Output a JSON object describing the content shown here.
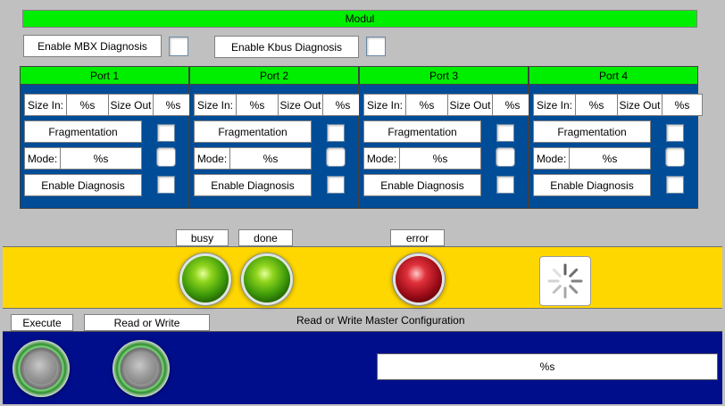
{
  "header": {
    "title": "Modul"
  },
  "global": {
    "mbx_diagnosis_label": "Enable MBX Diagnosis",
    "kbus_diagnosis_label": "Enable Kbus Diagnosis"
  },
  "ports": [
    {
      "title": "Port 1",
      "size_in_label": "Size In:",
      "size_in_value": "%s",
      "size_out_label": "Size Out",
      "size_out_value": "%s",
      "fragmentation_label": "Fragmentation",
      "mode_label": "Mode:",
      "mode_value": "%s",
      "enable_diagnosis_label": "Enable Diagnosis"
    },
    {
      "title": "Port 2",
      "size_in_label": "Size In:",
      "size_in_value": "%s",
      "size_out_label": "Size Out",
      "size_out_value": "%s",
      "fragmentation_label": "Fragmentation",
      "mode_label": "Mode:",
      "mode_value": "%s",
      "enable_diagnosis_label": "Enable Diagnosis"
    },
    {
      "title": "Port 3",
      "size_in_label": "Size In:",
      "size_in_value": "%s",
      "size_out_label": "Size Out",
      "size_out_value": "%s",
      "fragmentation_label": "Fragmentation",
      "mode_label": "Mode:",
      "mode_value": "%s",
      "enable_diagnosis_label": "Enable Diagnosis"
    },
    {
      "title": "Port 4",
      "size_in_label": "Size In:",
      "size_in_value": "%s",
      "size_out_label": "Size Out",
      "size_out_value": "%s",
      "fragmentation_label": "Fragmentation",
      "mode_label": "Mode:",
      "mode_value": "%s",
      "enable_diagnosis_label": "Enable Diagnosis"
    }
  ],
  "status": {
    "busy_label": "busy",
    "done_label": "done",
    "error_label": "error"
  },
  "colors": {
    "header_green": "#00ee00",
    "port_blue": "#004c97",
    "status_yellow": "#ffd700",
    "action_navy": "#000e8c"
  },
  "actions": {
    "execute_label": "Execute",
    "read_or_write_label": "Read or Write",
    "config_title": "Read or Write Master Configuration",
    "output_value": "%s"
  },
  "icons": {
    "busy_indicator": "loading-spinner-icon"
  }
}
